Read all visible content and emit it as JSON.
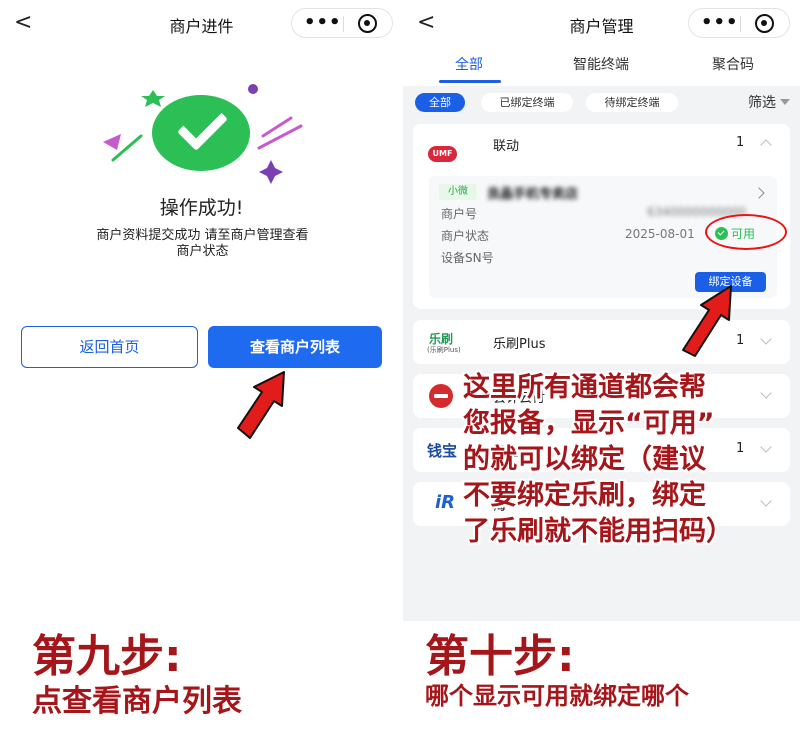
{
  "left": {
    "nav": {
      "title": "商户进件",
      "back": "<",
      "more": "•••"
    },
    "success_title": "操作成功!",
    "success_desc": "商户资料提交成功 请至商户管理查看商户状态",
    "buttons": {
      "home": "返回首页",
      "list": "查看商户列表"
    },
    "step_title": "第九步:",
    "step_sub": "点查看商户列表"
  },
  "right": {
    "nav": {
      "title": "商户管理",
      "back": "<",
      "more": "•••"
    },
    "tabs": [
      "全部",
      "智能终端",
      "聚合码"
    ],
    "chips": [
      "全部",
      "已绑定终端",
      "待绑定终端"
    ],
    "filter": "筛选",
    "cards": [
      {
        "logo": "UMF",
        "name": "联动",
        "count": "1",
        "expanded": true,
        "tag": "小微",
        "merchant_name": "良晶手机专卖店",
        "rows": [
          {
            "label": "商户号",
            "value": "6340000000000"
          },
          {
            "label": "商户状态",
            "value": "2025-08-01"
          },
          {
            "label": "设备SN号",
            "value": ""
          }
        ],
        "status": "可用",
        "bind_button": "绑定设备"
      },
      {
        "logo_top": "乐刷",
        "logo_bottom": "(乐刷Plus)",
        "name": "乐刷Plus",
        "count": "1"
      },
      {
        "name": "会计云付",
        "count": ""
      },
      {
        "logo": "钱宝",
        "name": "钱宝",
        "count": "1"
      },
      {
        "logo": "iR",
        "name": "海",
        "count": ""
      }
    ],
    "annotation": [
      "这里所有通道都会帮",
      "您报备，显示“可用”",
      "的就可以绑定（建议",
      "不要绑定乐刷，绑定",
      "了乐刷就不能用扫码）"
    ],
    "step_title": "第十步:",
    "step_sub": "哪个显示可用就绑定哪个"
  },
  "colors": {
    "accent": "#1a5fe6",
    "success": "#2bbf55",
    "annotation": "#a4161a",
    "arrow": "#e21b1b"
  }
}
